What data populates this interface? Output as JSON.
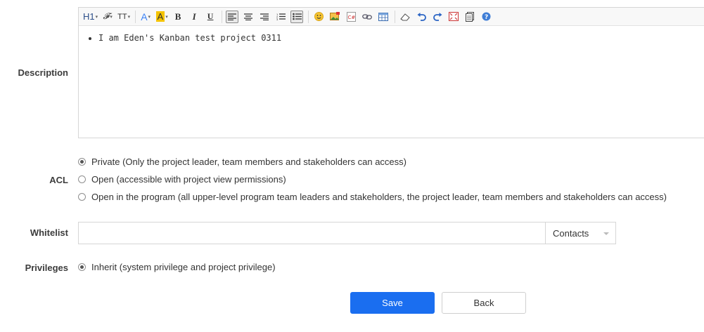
{
  "labels": {
    "description": "Description",
    "acl": "ACL",
    "whitelist": "Whitelist",
    "privileges": "Privileges"
  },
  "toolbar": {
    "heading": "H1",
    "font_family": "𝓕",
    "font_size": "TT",
    "font_color": "A",
    "bg_color": "A",
    "bold": "B",
    "italic": "I",
    "underline": "U"
  },
  "editor": {
    "content": "I am Eden's Kanban test project 0311"
  },
  "acl": {
    "options": [
      {
        "label": "Private (Only the project leader, team members and stakeholders can access)",
        "selected": true
      },
      {
        "label": "Open (accessible with project view permissions)",
        "selected": false
      },
      {
        "label": "Open in the program (all upper-level program team leaders and stakeholders, the project leader, team members and stakeholders can access)",
        "selected": false
      }
    ]
  },
  "whitelist": {
    "value": "",
    "select_value": "Contacts"
  },
  "privileges": {
    "option": "Inherit (system privilege and project privilege)",
    "selected": true
  },
  "buttons": {
    "save": "Save",
    "back": "Back"
  },
  "colors": {
    "primary": "#1a6ef0",
    "highlight": "#f5c400",
    "font_color_icon": "#3b82f6"
  }
}
